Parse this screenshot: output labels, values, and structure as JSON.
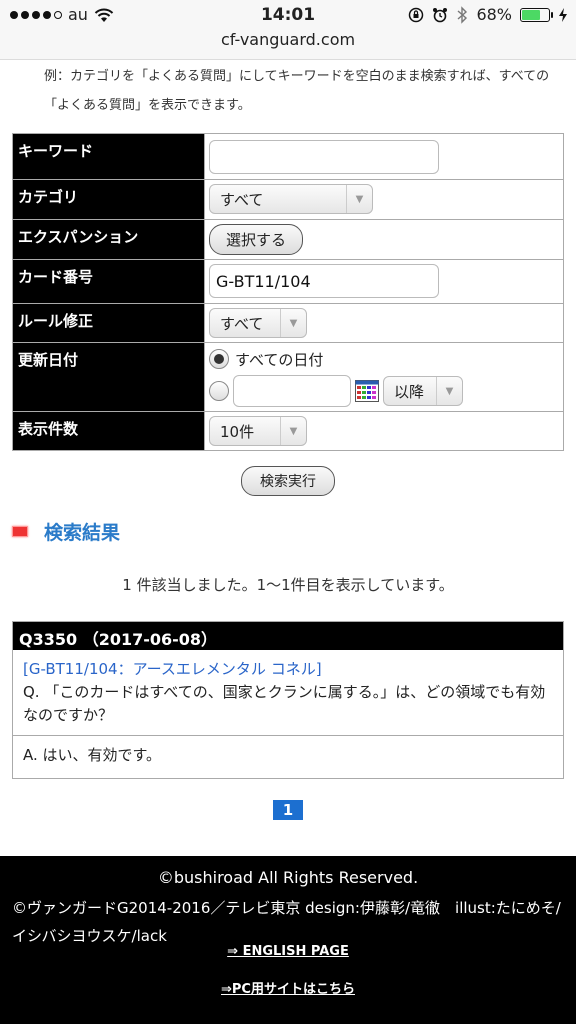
{
  "status": {
    "carrier": "au",
    "time": "14:01",
    "battery": "68%",
    "battery_level": 0.68,
    "url": "cf-vanguard.com"
  },
  "intro": {
    "text": "例：カテゴリを「よくある質問」にしてキーワードを空白のまま検索すれば、すべての「よくある質問」を表示できます。"
  },
  "form": {
    "keyword_label": "キーワード",
    "keyword_value": "",
    "category_label": "カテゴリ",
    "category_value": "すべて",
    "expansion_label": "エクスパンション",
    "expansion_button": "選択する",
    "cardno_label": "カード番号",
    "cardno_value": "G-BT11/104",
    "rule_label": "ルール修正",
    "rule_value": "すべて",
    "date_label": "更新日付",
    "date_all": "すべての日付",
    "date_value": "",
    "date_after": "以降",
    "count_label": "表示件数",
    "count_value": "10件",
    "submit": "検索実行"
  },
  "results": {
    "heading": "検索結果",
    "summary": "1 件該当しました。1〜1件目を表示しています。",
    "items": [
      {
        "header": "Q3350 （2017-06-08）",
        "card_link": "[G-BT11/104：アースエレメンタル コネル]",
        "question": "Q. 「このカードはすべての、国家とクランに属する。」は、どの領域でも有効なのですか？",
        "answer": "A. はい、有効です。"
      }
    ],
    "page": "1"
  },
  "footer": {
    "copyright1": "©bushiroad All Rights Reserved.",
    "copyright2": "©ヴァンガードG2014-2016／テレビ東京 design:伊藤彰/竜徹　illust:たにめそ/イシバシヨウスケ/lack",
    "english_link": "⇒ ENGLISH PAGE",
    "pc_link": "⇒PC用サイトはこちら"
  },
  "colors": {
    "accent": "#2a7bc9",
    "header_bg": "#000000",
    "page_active": "#1c6fd0",
    "battery": "#4cd964"
  }
}
